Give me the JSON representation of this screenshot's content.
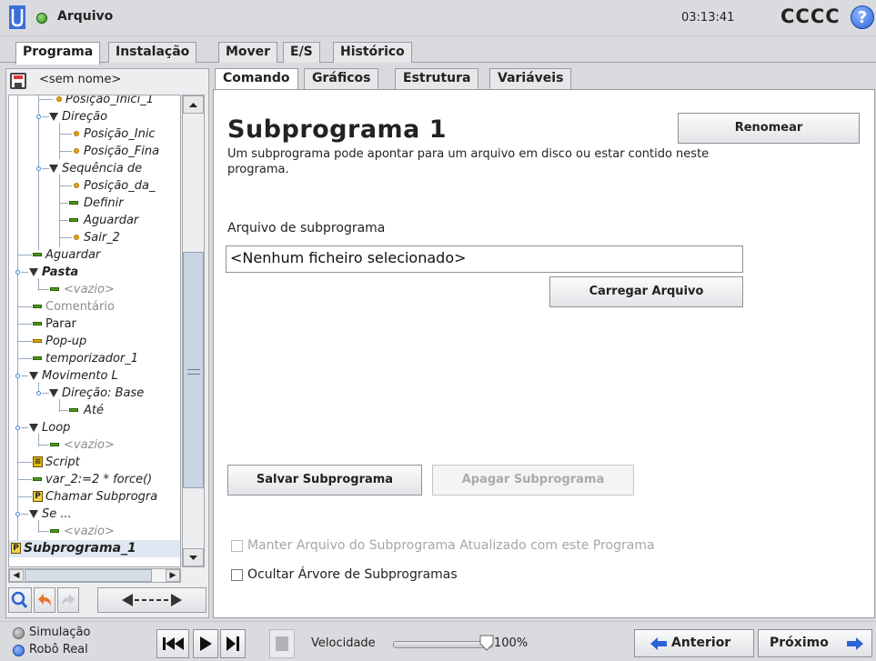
{
  "header": {
    "app_title": "Arquivo",
    "clock": "03:13:41",
    "robot_name": "CCCC",
    "help_symbol": "?"
  },
  "main_tabs": [
    {
      "label": "Programa",
      "active": true
    },
    {
      "label": "Instalação",
      "active": false
    },
    {
      "label": "Mover",
      "active": false
    },
    {
      "label": "E/S",
      "active": false
    },
    {
      "label": "Histórico",
      "active": false
    }
  ],
  "program": {
    "name": "<sem nome>"
  },
  "tree": [
    {
      "label": "Posição_Inici_1"
    },
    {
      "label": "Direção"
    },
    {
      "label": "Posição_Inic"
    },
    {
      "label": "Posição_Fina"
    },
    {
      "label": "Sequência de"
    },
    {
      "label": "Posição_da_"
    },
    {
      "label": "Definir"
    },
    {
      "label": "Aguardar"
    },
    {
      "label": "Sair_2"
    },
    {
      "label": "Aguardar"
    },
    {
      "label": "Pasta"
    },
    {
      "label": "<vazio>"
    },
    {
      "label": "Comentário"
    },
    {
      "label": "Parar"
    },
    {
      "label": "Pop-up"
    },
    {
      "label": "temporizador_1"
    },
    {
      "label": "Movimento L"
    },
    {
      "label": "Direção: Base"
    },
    {
      "label": "Até"
    },
    {
      "label": "Loop"
    },
    {
      "label": "<vazio>"
    },
    {
      "label": "Script"
    },
    {
      "label": "var_2:=2 * force()"
    },
    {
      "label": "Chamar Subprogra"
    },
    {
      "label": "Se ..."
    },
    {
      "label": "<vazio>"
    },
    {
      "label": "Subprograma_1"
    }
  ],
  "tree_tools": {
    "move_symbol": "◄----►"
  },
  "sub_tabs": [
    {
      "label": "Comando",
      "active": true
    },
    {
      "label": "Gráficos",
      "active": false
    },
    {
      "label": "Estrutura",
      "active": false
    },
    {
      "label": "Variáveis",
      "active": false
    }
  ],
  "subprogram": {
    "title": "Subprograma 1",
    "description": "Um subprograma pode apontar para um arquivo em disco ou estar contido neste programa.",
    "rename_label": "Renomear",
    "file_label": "Arquivo de subprograma",
    "file_value": "<Nenhum ficheiro selecionado>",
    "load_label": "Carregar Arquivo",
    "save_label": "Salvar Subprograma",
    "delete_label": "Apagar Subprograma",
    "keep_updated_label": "Manter Arquivo do Subprograma Atualizado com este Programa",
    "keep_updated_checked": false,
    "hide_tree_label": "Ocultar Árvore de Subprogramas",
    "hide_tree_checked": false
  },
  "footer": {
    "mode_simulation": "Simulação",
    "mode_real": "Robô Real",
    "speed_label": "Velocidade",
    "speed_value": "100%",
    "speed_fraction": 1.0,
    "prev_label": "Anterior",
    "next_label": "Próximo"
  },
  "colors": {
    "accent_blue": "#2d63d6",
    "green_status": "#2e8a19",
    "node_green": "#4a9a18",
    "node_yellow": "#e0a21c",
    "arrow_orange": "#e8742a"
  }
}
